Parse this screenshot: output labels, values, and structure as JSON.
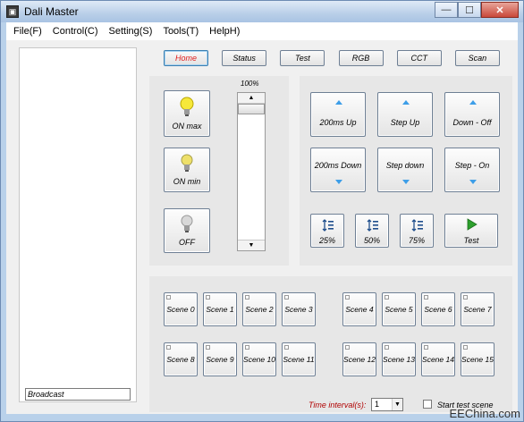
{
  "window": {
    "title": "Dali Master",
    "minimize": "—",
    "maximize": "☐",
    "close": "✕"
  },
  "menu": [
    "File(F)",
    "Control(C)",
    "Setting(S)",
    "Tools(T)",
    "HelpH)"
  ],
  "left": {
    "broadcast": "Broadcast"
  },
  "tabs": [
    {
      "label": "Home",
      "active": true
    },
    {
      "label": "Status"
    },
    {
      "label": "Test"
    },
    {
      "label": "RGB"
    },
    {
      "label": "CCT"
    },
    {
      "label": "Scan"
    }
  ],
  "lamp": {
    "on_max": "ON max",
    "on_min": "ON min",
    "off": "OFF"
  },
  "slider": {
    "percent_label": "100%",
    "level": 1.0
  },
  "controls": {
    "up200": "200ms Up",
    "step_up": "Step Up",
    "down_off": "Down - Off",
    "down200": "200ms Down",
    "step_down": "Step down",
    "step_on": "Step - On"
  },
  "levels": {
    "p25": "25%",
    "p50": "50%",
    "p75": "75%",
    "test": "Test"
  },
  "scenes": [
    "Scene 0",
    "Scene 1",
    "Scene 2",
    "Scene 3",
    "Scene 4",
    "Scene 5",
    "Scene 6",
    "Scene 7",
    "Scene 8",
    "Scene 9",
    "Scene 10",
    "Scene 11",
    "Scene 12",
    "Scene 13",
    "Scene 14",
    "Scene 15"
  ],
  "time_interval": {
    "label": "Time interval(s):",
    "value": "1"
  },
  "start_test": {
    "label": "Start test scene",
    "checked": false
  },
  "watermark": "EEChina.com",
  "colors": {
    "active_tab": "#e02020",
    "arrow": "#3d9ee8",
    "time_label": "#b00000"
  }
}
